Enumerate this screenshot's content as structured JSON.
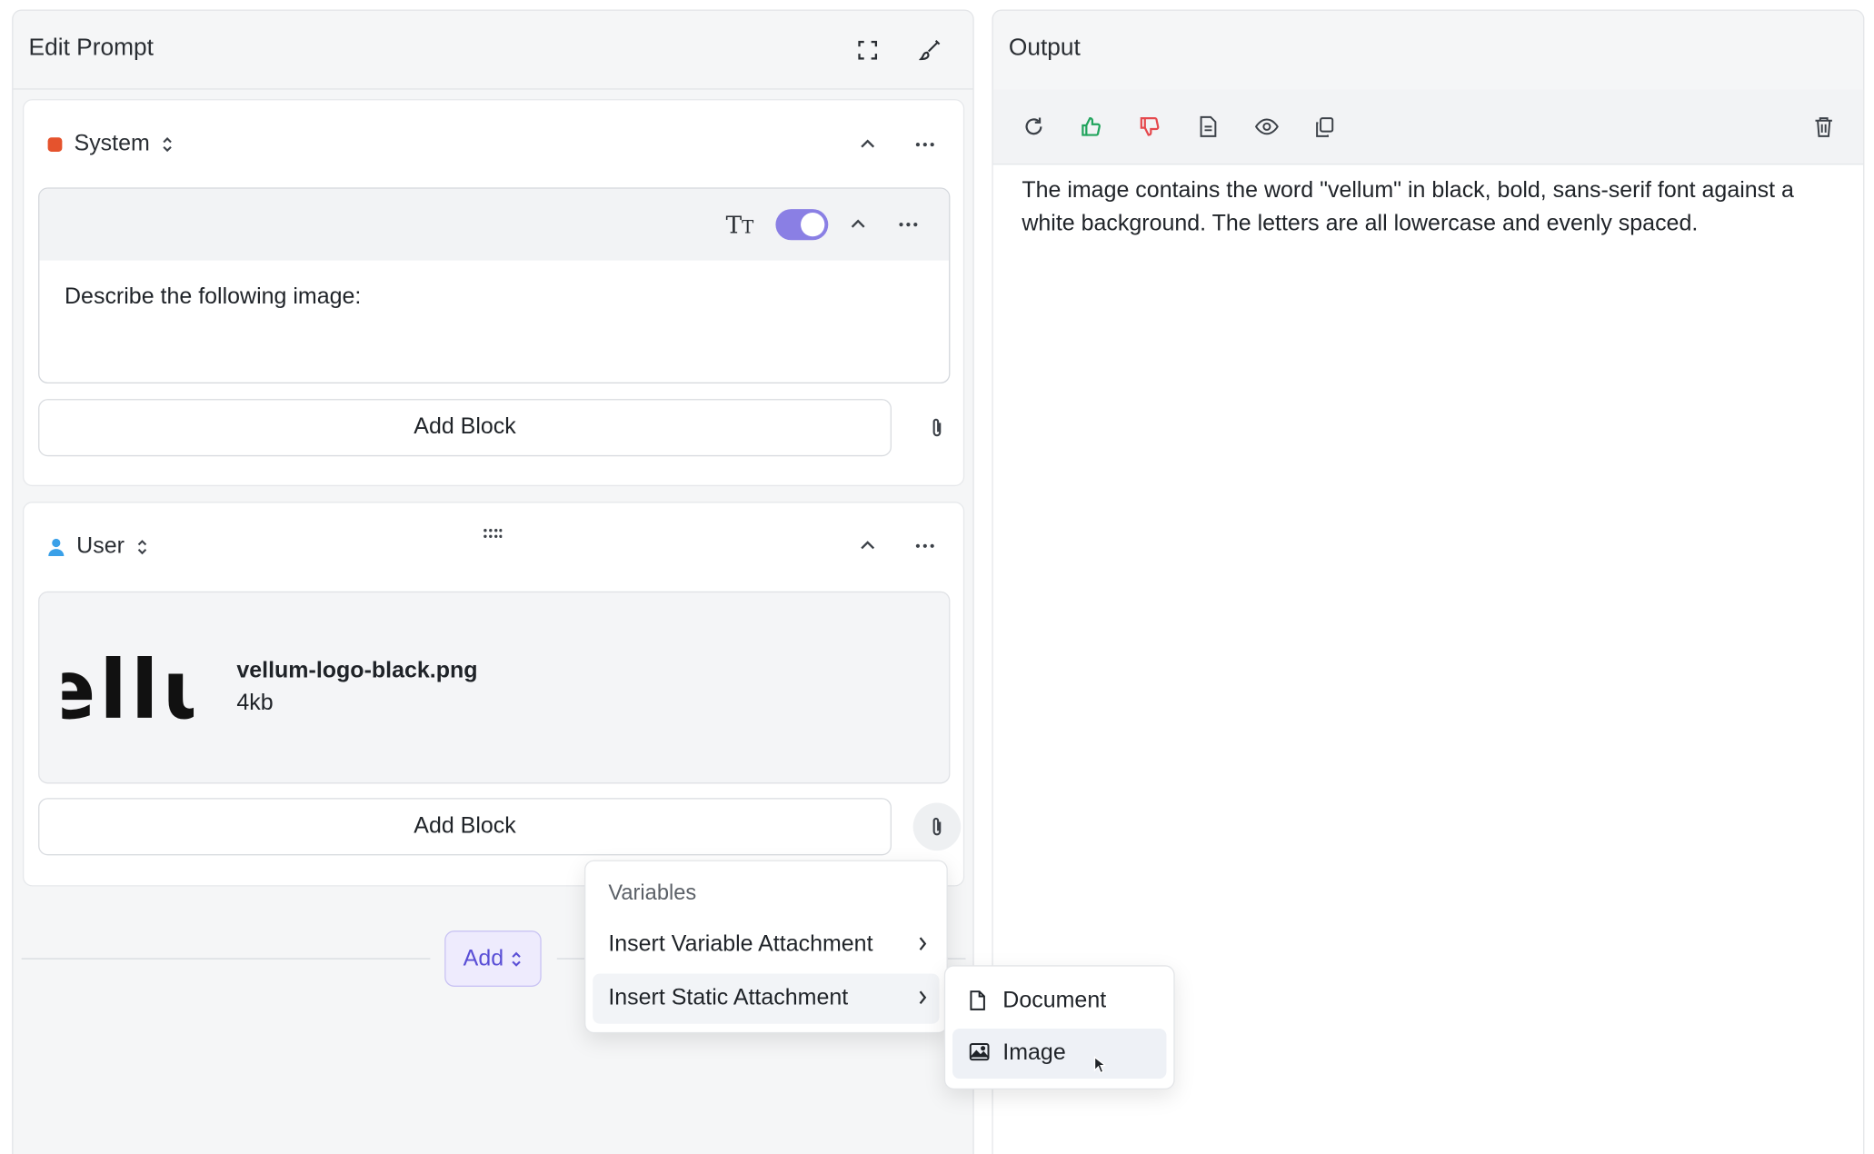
{
  "colors": {
    "accent": "#8a7fe4",
    "accent_text": "#5a4fd6",
    "thumb_up": "#22a45d",
    "thumb_down": "#e5484d",
    "system_badge": "#e5532d",
    "user_icon": "#3aa0e8"
  },
  "edit_panel": {
    "title": "Edit Prompt",
    "header_icons": [
      "expand-icon",
      "brush-icon"
    ]
  },
  "system_card": {
    "role_label": "System",
    "block_text": "Describe the following image:",
    "toggle_on": true,
    "add_block_label": "Add Block"
  },
  "user_card": {
    "role_label": "User",
    "attachment": {
      "thumbnail_text": "ellu",
      "file_name": "vellum-logo-black.png",
      "file_size": "4kb"
    },
    "add_block_label": "Add Block"
  },
  "add_button": {
    "label": "Add"
  },
  "context_menu": {
    "section_label": "Variables",
    "items": [
      {
        "label": "Insert Variable Attachment"
      },
      {
        "label": "Insert Static Attachment"
      }
    ]
  },
  "submenu": {
    "items": [
      {
        "label": "Document",
        "icon": "document-icon"
      },
      {
        "label": "Image",
        "icon": "image-icon"
      }
    ]
  },
  "output_panel": {
    "title": "Output",
    "text": "The image contains the word \"vellum\" in black, bold, sans-serif font against a white background. The letters are all lowercase and evenly spaced.",
    "toolbar_icons": [
      "refresh-icon",
      "thumbs-up-icon",
      "thumbs-down-icon",
      "document-icon",
      "eye-icon",
      "copy-icon",
      "trash-icon"
    ]
  }
}
